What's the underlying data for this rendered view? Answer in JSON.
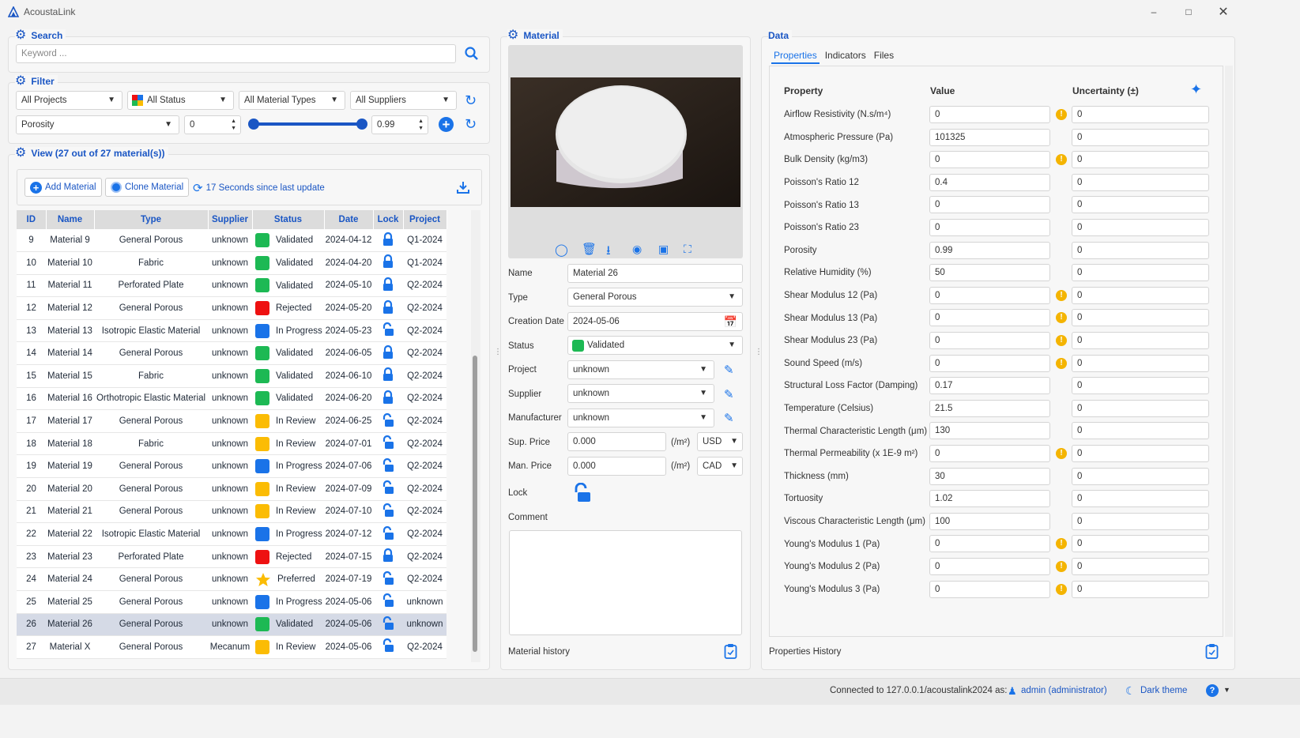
{
  "window": {
    "title": "AcoustaLink",
    "min_icon": "minimize-icon",
    "max_icon": "maximize-icon",
    "close_icon": "close-icon"
  },
  "search": {
    "title": "Search",
    "placeholder": "Keyword ..."
  },
  "filter": {
    "title": "Filter",
    "project": "All Projects",
    "status": "All Status",
    "material_type": "All Material Types",
    "supplier": "All Suppliers",
    "property": "Porosity",
    "min_value": "0",
    "max_value": "0.99",
    "slider_min": 0,
    "slider_max": 0.99
  },
  "view": {
    "title": "View (27 out of 27 material(s))",
    "add_label": "Add Material",
    "clone_label": "Clone Material",
    "update_label": "17 Seconds since last update",
    "columns": [
      "ID",
      "Name",
      "Type",
      "Supplier",
      "Status",
      "Date",
      "Lock",
      "Project"
    ],
    "rows": [
      {
        "id": "9",
        "name": "Material 9",
        "type": "General Porous",
        "supplier": "unknown",
        "status": "Validated",
        "color": "#1db954",
        "date": "2024-04-12",
        "locked": true,
        "project": "Q1-2024"
      },
      {
        "id": "10",
        "name": "Material 10",
        "type": "Fabric",
        "supplier": "unknown",
        "status": "Validated",
        "color": "#1db954",
        "date": "2024-04-20",
        "locked": true,
        "project": "Q1-2024"
      },
      {
        "id": "11",
        "name": "Material 11",
        "type": "Perforated Plate",
        "supplier": "unknown",
        "status": "Validated",
        "color": "#1db954",
        "date": "2024-05-10",
        "locked": true,
        "project": "Q2-2024"
      },
      {
        "id": "12",
        "name": "Material 12",
        "type": "General Porous",
        "supplier": "unknown",
        "status": "Rejected",
        "color": "#ee1111",
        "date": "2024-05-20",
        "locked": true,
        "project": "Q2-2024"
      },
      {
        "id": "13",
        "name": "Material 13",
        "type": "Isotropic Elastic Material",
        "supplier": "unknown",
        "status": "In Progress",
        "color": "#1a73e8",
        "date": "2024-05-23",
        "locked": false,
        "project": "Q2-2024"
      },
      {
        "id": "14",
        "name": "Material 14",
        "type": "General Porous",
        "supplier": "unknown",
        "status": "Validated",
        "color": "#1db954",
        "date": "2024-06-05",
        "locked": true,
        "project": "Q2-2024"
      },
      {
        "id": "15",
        "name": "Material 15",
        "type": "Fabric",
        "supplier": "unknown",
        "status": "Validated",
        "color": "#1db954",
        "date": "2024-06-10",
        "locked": true,
        "project": "Q2-2024"
      },
      {
        "id": "16",
        "name": "Material 16",
        "type": "Orthotropic Elastic Material",
        "supplier": "unknown",
        "status": "Validated",
        "color": "#1db954",
        "date": "2024-06-20",
        "locked": true,
        "project": "Q2-2024"
      },
      {
        "id": "17",
        "name": "Material 17",
        "type": "General Porous",
        "supplier": "unknown",
        "status": "In Review",
        "color": "#fbbc04",
        "date": "2024-06-25",
        "locked": false,
        "project": "Q2-2024"
      },
      {
        "id": "18",
        "name": "Material 18",
        "type": "Fabric",
        "supplier": "unknown",
        "status": "In Review",
        "color": "#fbbc04",
        "date": "2024-07-01",
        "locked": false,
        "project": "Q2-2024"
      },
      {
        "id": "19",
        "name": "Material 19",
        "type": "General Porous",
        "supplier": "unknown",
        "status": "In Progress",
        "color": "#1a73e8",
        "date": "2024-07-06",
        "locked": false,
        "project": "Q2-2024"
      },
      {
        "id": "20",
        "name": "Material 20",
        "type": "General Porous",
        "supplier": "unknown",
        "status": "In Review",
        "color": "#fbbc04",
        "date": "2024-07-09",
        "locked": false,
        "project": "Q2-2024"
      },
      {
        "id": "21",
        "name": "Material 21",
        "type": "General Porous",
        "supplier": "unknown",
        "status": "In Review",
        "color": "#fbbc04",
        "date": "2024-07-10",
        "locked": false,
        "project": "Q2-2024"
      },
      {
        "id": "22",
        "name": "Material 22",
        "type": "Isotropic Elastic Material",
        "supplier": "unknown",
        "status": "In Progress",
        "color": "#1a73e8",
        "date": "2024-07-12",
        "locked": false,
        "project": "Q2-2024"
      },
      {
        "id": "23",
        "name": "Material 23",
        "type": "Perforated Plate",
        "supplier": "unknown",
        "status": "Rejected",
        "color": "#ee1111",
        "date": "2024-07-15",
        "locked": true,
        "project": "Q2-2024"
      },
      {
        "id": "24",
        "name": "Material 24",
        "type": "General Porous",
        "supplier": "unknown",
        "status": "Preferred",
        "color": "star",
        "date": "2024-07-19",
        "locked": false,
        "project": "Q2-2024"
      },
      {
        "id": "25",
        "name": "Material 25",
        "type": "General Porous",
        "supplier": "unknown",
        "status": "In Progress",
        "color": "#1a73e8",
        "date": "2024-05-06",
        "locked": false,
        "project": "unknown"
      },
      {
        "id": "26",
        "name": "Material 26",
        "type": "General Porous",
        "supplier": "unknown",
        "status": "Validated",
        "color": "#1db954",
        "date": "2024-05-06",
        "locked": false,
        "project": "unknown",
        "selected": true
      },
      {
        "id": "27",
        "name": "Material X",
        "type": "General Porous",
        "supplier": "Mecanum",
        "status": "In Review",
        "color": "#fbbc04",
        "date": "2024-05-06",
        "locked": false,
        "project": "Q2-2024"
      }
    ]
  },
  "material": {
    "title": "Material",
    "labels": {
      "name": "Name",
      "type": "Type",
      "creation_date": "Creation Date",
      "status": "Status",
      "project": "Project",
      "supplier": "Supplier",
      "manufacturer": "Manufacturer",
      "sup_price": "Sup. Price",
      "man_price": "Man. Price",
      "lock": "Lock",
      "comment": "Comment"
    },
    "name": "Material 26",
    "type": "General Porous",
    "creation_date": "2024-05-06",
    "status": "Validated",
    "project": "unknown",
    "supplier": "unknown",
    "manufacturer": "unknown",
    "sup_price": "0.000",
    "man_price": "0.000",
    "unit": "(/m²)",
    "sup_currency": "USD",
    "man_currency": "CAD",
    "history_label": "Material history"
  },
  "data": {
    "title": "Data",
    "tabs": [
      "Properties",
      "Indicators",
      "Files"
    ],
    "headers": {
      "property": "Property",
      "value": "Value",
      "uncertainty": "Uncertainty (±)"
    },
    "properties": [
      {
        "name": "Airflow Resistivity (N.s/m⁴)",
        "value": "0",
        "warn": true,
        "unc": "0"
      },
      {
        "name": "Atmospheric Pressure (Pa)",
        "value": "101325",
        "warn": false,
        "unc": "0"
      },
      {
        "name": "Bulk Density (kg/m3)",
        "value": "0",
        "warn": true,
        "unc": "0"
      },
      {
        "name": "Poisson's Ratio 12",
        "value": "0.4",
        "warn": false,
        "unc": "0"
      },
      {
        "name": "Poisson's Ratio 13",
        "value": "0",
        "warn": false,
        "unc": "0"
      },
      {
        "name": "Poisson's Ratio 23",
        "value": "0",
        "warn": false,
        "unc": "0"
      },
      {
        "name": "Porosity",
        "value": "0.99",
        "warn": false,
        "unc": "0"
      },
      {
        "name": "Relative Humidity (%)",
        "value": "50",
        "warn": false,
        "unc": "0"
      },
      {
        "name": "Shear Modulus 12 (Pa)",
        "value": "0",
        "warn": true,
        "unc": "0"
      },
      {
        "name": "Shear Modulus 13 (Pa)",
        "value": "0",
        "warn": true,
        "unc": "0"
      },
      {
        "name": "Shear Modulus 23 (Pa)",
        "value": "0",
        "warn": true,
        "unc": "0"
      },
      {
        "name": "Sound Speed (m/s)",
        "value": "0",
        "warn": true,
        "unc": "0"
      },
      {
        "name": "Structural Loss Factor (Damping)",
        "value": "0.17",
        "warn": false,
        "unc": "0"
      },
      {
        "name": "Temperature (Celsius)",
        "value": "21.5",
        "warn": false,
        "unc": "0"
      },
      {
        "name": "Thermal Characteristic Length (μm)",
        "value": "130",
        "warn": false,
        "unc": "0"
      },
      {
        "name": "Thermal Permeability (x 1E-9 m²)",
        "value": "0",
        "warn": true,
        "unc": "0"
      },
      {
        "name": "Thickness (mm)",
        "value": "30",
        "warn": false,
        "unc": "0"
      },
      {
        "name": "Tortuosity",
        "value": "1.02",
        "warn": false,
        "unc": "0"
      },
      {
        "name": "Viscous Characteristic Length (μm)",
        "value": "100",
        "warn": false,
        "unc": "0"
      },
      {
        "name": "Young's Modulus 1 (Pa)",
        "value": "0",
        "warn": true,
        "unc": "0"
      },
      {
        "name": "Young's Modulus 2 (Pa)",
        "value": "0",
        "warn": true,
        "unc": "0"
      },
      {
        "name": "Young's Modulus 3 (Pa)",
        "value": "0",
        "warn": true,
        "unc": "0"
      }
    ],
    "history_label": "Properties History"
  },
  "statusbar": {
    "connection": "Connected to 127.0.0.1/acoustalink2024 as:",
    "user": "admin (administrator)",
    "theme": "Dark theme"
  }
}
